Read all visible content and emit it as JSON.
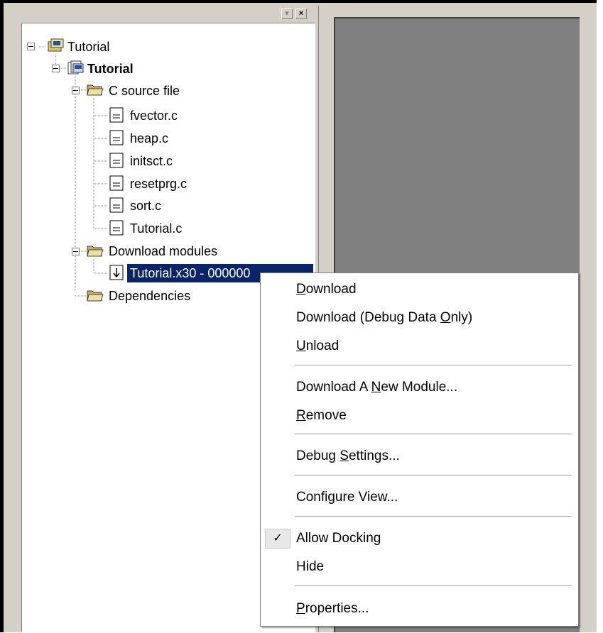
{
  "tree": {
    "root": "Tutorial",
    "project": "Tutorial",
    "folders": {
      "c_source": "C source file",
      "download_modules": "Download modules",
      "dependencies": "Dependencies"
    },
    "c_files": [
      "fvector.c",
      "heap.c",
      "initsct.c",
      "resetprg.c",
      "sort.c",
      "Tutorial.c"
    ],
    "module": "Tutorial.x30 - 000000"
  },
  "titlebar": {
    "close_glyph": "×"
  },
  "menu": {
    "items": [
      {
        "pre": "",
        "mn": "D",
        "post": "ownload"
      },
      {
        "pre": "Download (Debug Data ",
        "mn": "O",
        "post": "nly)"
      },
      {
        "pre": "",
        "mn": "U",
        "post": "nload"
      },
      {
        "pre": "Download A ",
        "mn": "N",
        "post": "ew Module..."
      },
      {
        "pre": "",
        "mn": "R",
        "post": "emove"
      },
      {
        "pre": "Debug ",
        "mn": "S",
        "post": "ettings..."
      },
      {
        "pre": "Configure View...",
        "mn": "",
        "post": ""
      },
      {
        "pre": "Allow Docking",
        "mn": "",
        "post": ""
      },
      {
        "pre": "Hide",
        "mn": "",
        "post": ""
      },
      {
        "pre": "",
        "mn": "P",
        "post": "roperties..."
      }
    ],
    "check_mark": "✓"
  }
}
